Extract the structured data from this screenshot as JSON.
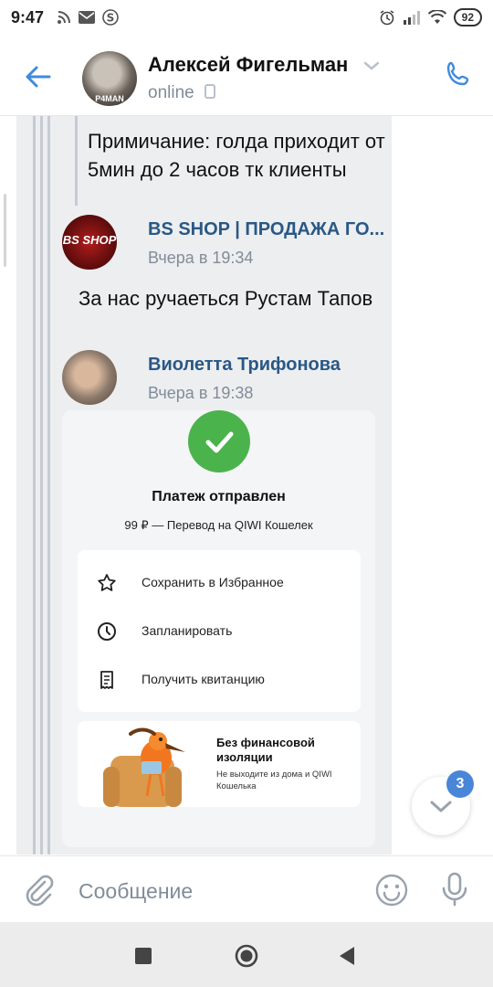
{
  "status_bar": {
    "time": "9:47",
    "battery": "92"
  },
  "header": {
    "avatar_text": "P4MAN",
    "contact_name": "Алексей Фигельман",
    "contact_status": "online"
  },
  "chat": {
    "forwarded_note": "Примичание: голда приходит от 5мин до 2 часов тк клиенты",
    "shop_message": {
      "author": "BS SHOP | ПРОДАЖА ГО...",
      "avatar_text": "BS SHOP",
      "time": "Вчера в 19:34",
      "text": "За нас ручаеться Рустам Тапов"
    },
    "user_message": {
      "author": "Виолетта Трифонова",
      "time": "Вчера в 19:38"
    },
    "receipt": {
      "title": "Платеж отправлен",
      "subtitle": "99 ₽ — Перевод на QIWI Кошелек",
      "actions": [
        {
          "label": "Сохранить в Избранное",
          "icon": "star-icon"
        },
        {
          "label": "Запланировать",
          "icon": "clock-icon"
        },
        {
          "label": "Получить квитанцию",
          "icon": "receipt-icon"
        }
      ],
      "promo_title": "Без финансовой изоляции",
      "promo_text": "Не выходите из дома и QIWI Кошелька"
    }
  },
  "scroll_down": {
    "unread_count": "3"
  },
  "input": {
    "placeholder": "Сообщение"
  },
  "colors": {
    "accent": "#2a5885",
    "link_blue": "#4a86d8",
    "success_green": "#4bb34b",
    "bubble_bg": "#edeef0",
    "muted": "#818c99"
  }
}
